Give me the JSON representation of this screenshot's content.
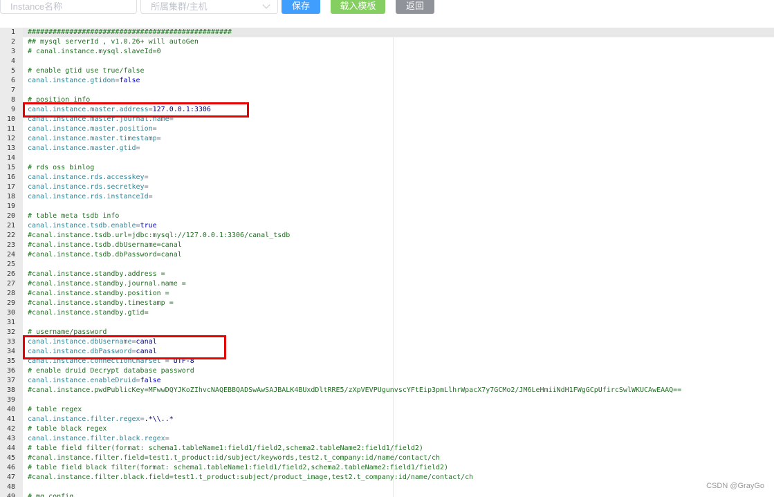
{
  "toolbar": {
    "instance_placeholder": "Instance名称",
    "cluster_placeholder": "所属集群/主机",
    "save_label": "保存",
    "load_template_label": "载入模板",
    "back_label": "返回"
  },
  "editor": {
    "lines": [
      {
        "n": "1",
        "parts": [
          [
            "comment",
            "#################################################"
          ]
        ]
      },
      {
        "n": "2",
        "parts": [
          [
            "comment",
            "## mysql serverId , v1.0.26+ will autoGen"
          ]
        ]
      },
      {
        "n": "3",
        "parts": [
          [
            "comment",
            "# canal.instance.mysql.slaveId=0"
          ]
        ]
      },
      {
        "n": "4",
        "parts": []
      },
      {
        "n": "5",
        "parts": [
          [
            "comment",
            "# enable gtid use true/false"
          ]
        ]
      },
      {
        "n": "6",
        "parts": [
          [
            "key",
            "canal.instance.gtidon"
          ],
          [
            "eq",
            "="
          ],
          [
            "bool",
            "false"
          ]
        ]
      },
      {
        "n": "7",
        "parts": []
      },
      {
        "n": "8",
        "parts": [
          [
            "comment",
            "# position info"
          ]
        ]
      },
      {
        "n": "9",
        "parts": [
          [
            "key",
            "canal.instance.master.address"
          ],
          [
            "eq",
            "="
          ],
          [
            "val",
            "127.0.0.1:3306"
          ]
        ]
      },
      {
        "n": "10",
        "parts": [
          [
            "key",
            "canal.instance.master.journal.name"
          ],
          [
            "eq",
            "="
          ]
        ]
      },
      {
        "n": "11",
        "parts": [
          [
            "key",
            "canal.instance.master.position"
          ],
          [
            "eq",
            "="
          ]
        ]
      },
      {
        "n": "12",
        "parts": [
          [
            "key",
            "canal.instance.master.timestamp"
          ],
          [
            "eq",
            "="
          ]
        ]
      },
      {
        "n": "13",
        "parts": [
          [
            "key",
            "canal.instance.master.gtid"
          ],
          [
            "eq",
            "="
          ]
        ]
      },
      {
        "n": "14",
        "parts": []
      },
      {
        "n": "15",
        "parts": [
          [
            "comment",
            "# rds oss binlog"
          ]
        ]
      },
      {
        "n": "16",
        "parts": [
          [
            "key",
            "canal.instance.rds.accesskey"
          ],
          [
            "eq",
            "="
          ]
        ]
      },
      {
        "n": "17",
        "parts": [
          [
            "key",
            "canal.instance.rds.secretkey"
          ],
          [
            "eq",
            "="
          ]
        ]
      },
      {
        "n": "18",
        "parts": [
          [
            "key",
            "canal.instance.rds.instanceId"
          ],
          [
            "eq",
            "="
          ]
        ]
      },
      {
        "n": "19",
        "parts": []
      },
      {
        "n": "20",
        "parts": [
          [
            "comment",
            "# table meta tsdb info"
          ]
        ]
      },
      {
        "n": "21",
        "parts": [
          [
            "key",
            "canal.instance.tsdb.enable"
          ],
          [
            "eq",
            "="
          ],
          [
            "bool",
            "true"
          ]
        ]
      },
      {
        "n": "22",
        "parts": [
          [
            "comment",
            "#canal.instance.tsdb.url=jdbc:mysql://127.0.0.1:3306/canal_tsdb"
          ]
        ]
      },
      {
        "n": "23",
        "parts": [
          [
            "comment",
            "#canal.instance.tsdb.dbUsername=canal"
          ]
        ]
      },
      {
        "n": "24",
        "parts": [
          [
            "comment",
            "#canal.instance.tsdb.dbPassword=canal"
          ]
        ]
      },
      {
        "n": "25",
        "parts": []
      },
      {
        "n": "26",
        "parts": [
          [
            "comment",
            "#canal.instance.standby.address ="
          ]
        ]
      },
      {
        "n": "27",
        "parts": [
          [
            "comment",
            "#canal.instance.standby.journal.name ="
          ]
        ]
      },
      {
        "n": "28",
        "parts": [
          [
            "comment",
            "#canal.instance.standby.position ="
          ]
        ]
      },
      {
        "n": "29",
        "parts": [
          [
            "comment",
            "#canal.instance.standby.timestamp ="
          ]
        ]
      },
      {
        "n": "30",
        "parts": [
          [
            "comment",
            "#canal.instance.standby.gtid="
          ]
        ]
      },
      {
        "n": "31",
        "parts": []
      },
      {
        "n": "32",
        "parts": [
          [
            "comment",
            "# username/password"
          ]
        ]
      },
      {
        "n": "33",
        "parts": [
          [
            "key",
            "canal.instance.dbUsername"
          ],
          [
            "eq",
            "="
          ],
          [
            "val",
            "canal"
          ]
        ]
      },
      {
        "n": "34",
        "parts": [
          [
            "key",
            "canal.instance.dbPassword"
          ],
          [
            "eq",
            "="
          ],
          [
            "val",
            "canal"
          ]
        ]
      },
      {
        "n": "35",
        "parts": [
          [
            "key",
            "canal.instance.connectionCharset"
          ],
          [
            "eq",
            " = "
          ],
          [
            "val",
            "UTF-8"
          ]
        ]
      },
      {
        "n": "36",
        "parts": [
          [
            "comment",
            "# enable druid Decrypt database password"
          ]
        ]
      },
      {
        "n": "37",
        "parts": [
          [
            "key",
            "canal.instance.enableDruid"
          ],
          [
            "eq",
            "="
          ],
          [
            "bool",
            "false"
          ]
        ]
      },
      {
        "n": "38",
        "parts": [
          [
            "comment",
            "#canal.instance.pwdPublicKey=MFwwDQYJKoZIhvcNAQEBBQADSwAwSAJBALK4BUxdDltRRE5/zXpVEVPUgunvscYFtEip3pmLlhrWpacX7y7GCMo2/JM6LeHmiiNdH1FWgGCpUfircSwlWKUCAwEAAQ=="
          ]
        ]
      },
      {
        "n": "39",
        "parts": []
      },
      {
        "n": "40",
        "parts": [
          [
            "comment",
            "# table regex"
          ]
        ]
      },
      {
        "n": "41",
        "parts": [
          [
            "key",
            "canal.instance.filter.regex"
          ],
          [
            "eq",
            "="
          ],
          [
            "val",
            ".*\\\\..*"
          ]
        ]
      },
      {
        "n": "42",
        "parts": [
          [
            "comment",
            "# table black regex"
          ]
        ]
      },
      {
        "n": "43",
        "parts": [
          [
            "key",
            "canal.instance.filter.black.regex"
          ],
          [
            "eq",
            "="
          ]
        ]
      },
      {
        "n": "44",
        "parts": [
          [
            "comment",
            "# table field filter(format: schema1.tableName1:field1/field2,schema2.tableName2:field1/field2)"
          ]
        ]
      },
      {
        "n": "45",
        "parts": [
          [
            "comment",
            "#canal.instance.filter.field=test1.t_product:id/subject/keywords,test2.t_company:id/name/contact/ch"
          ]
        ]
      },
      {
        "n": "46",
        "parts": [
          [
            "comment",
            "# table field black filter(format: schema1.tableName1:field1/field2,schema2.tableName2:field1/field2)"
          ]
        ]
      },
      {
        "n": "47",
        "parts": [
          [
            "comment",
            "#canal.instance.filter.black.field=test1.t_product:subject/product_image,test2.t_company:id/name/contact/ch"
          ]
        ]
      },
      {
        "n": "48",
        "parts": []
      },
      {
        "n": "49",
        "parts": [
          [
            "comment",
            "# mq config"
          ]
        ]
      }
    ]
  },
  "watermark": "CSDN @GrayGo",
  "colors": {
    "primary": "#409eff",
    "success": "#85ce61",
    "info": "#909399",
    "highlight_border": "#e60000"
  }
}
